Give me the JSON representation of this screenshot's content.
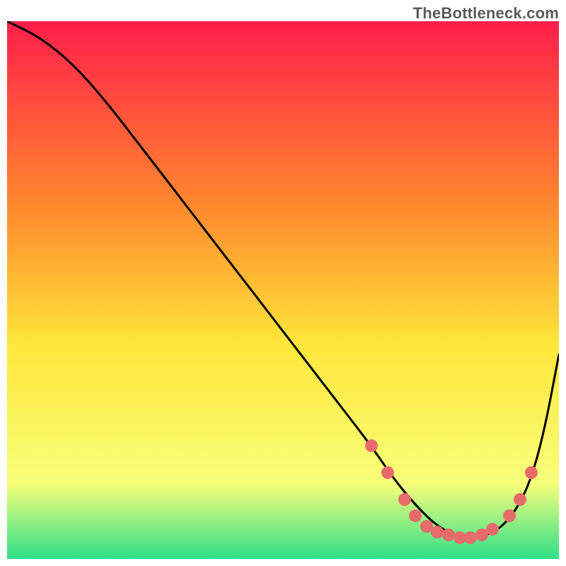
{
  "attribution": "TheBottleneck.com",
  "colors": {
    "gradient_top": "#ff1e4a",
    "gradient_mid_upper": "#ff8a2e",
    "gradient_mid": "#ffe63a",
    "gradient_lower": "#f7ff7a",
    "gradient_bottom": "#2fe08a",
    "curve": "#000000",
    "dot": "#e76b6b"
  },
  "chart_data": {
    "type": "line",
    "title": "",
    "xlabel": "",
    "ylabel": "",
    "xlim": [
      0,
      100
    ],
    "ylim": [
      0,
      100
    ],
    "grid": false,
    "series": [
      {
        "name": "bottleneck-curve",
        "x": [
          0,
          6,
          12,
          18,
          24,
          30,
          36,
          42,
          48,
          54,
          60,
          66,
          70,
          74,
          78,
          82,
          86,
          90,
          94,
          97,
          100
        ],
        "y": [
          100,
          97,
          92,
          85,
          77,
          69,
          61,
          53,
          45,
          37,
          29,
          21,
          15,
          10,
          6,
          4,
          4,
          6,
          12,
          22,
          38
        ]
      }
    ],
    "annotations": {
      "dots": [
        {
          "x": 66,
          "y": 21
        },
        {
          "x": 69,
          "y": 16
        },
        {
          "x": 72,
          "y": 11
        },
        {
          "x": 74,
          "y": 8
        },
        {
          "x": 76,
          "y": 6
        },
        {
          "x": 78,
          "y": 5
        },
        {
          "x": 80,
          "y": 4.5
        },
        {
          "x": 82,
          "y": 4
        },
        {
          "x": 84,
          "y": 4
        },
        {
          "x": 86,
          "y": 4.5
        },
        {
          "x": 88,
          "y": 5.5
        },
        {
          "x": 91,
          "y": 8
        },
        {
          "x": 93,
          "y": 11
        },
        {
          "x": 95,
          "y": 16
        }
      ]
    }
  }
}
